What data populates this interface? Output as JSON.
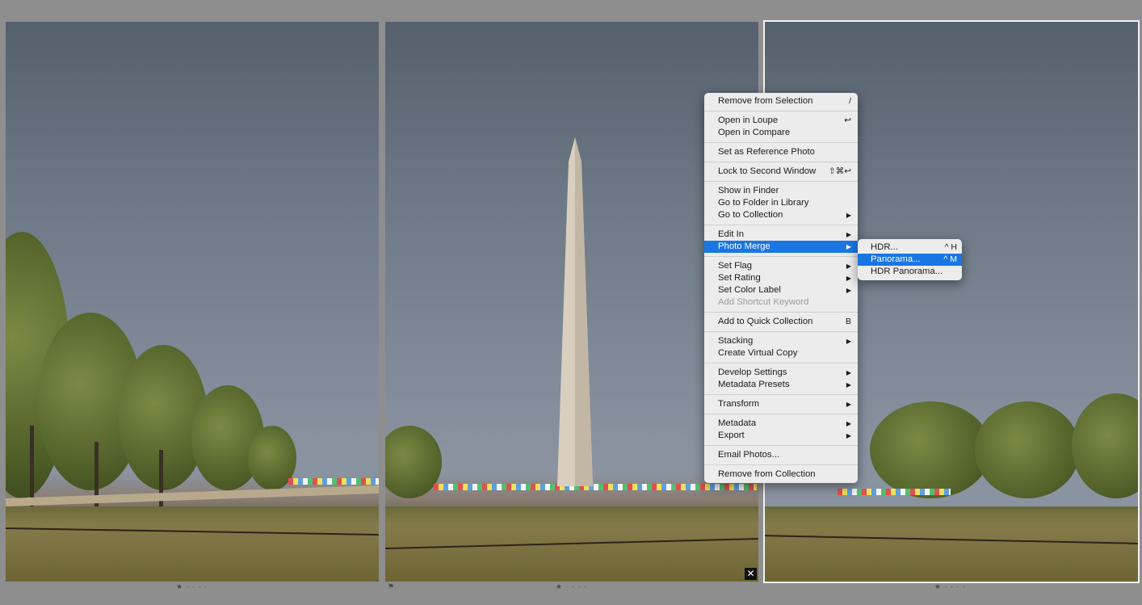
{
  "photos": [
    {
      "rating": "★ · · · ·"
    },
    {
      "rating": "★ · · · ·"
    },
    {
      "rating": "★ · · · ·"
    }
  ],
  "icons": {
    "flag": "⚑",
    "close": "✕"
  },
  "context_menu": {
    "groups": [
      [
        {
          "label": "Remove from Selection",
          "shortcut": "/"
        }
      ],
      [
        {
          "label": "Open in Loupe",
          "shortcut": "↩"
        },
        {
          "label": "Open in Compare"
        }
      ],
      [
        {
          "label": "Set as Reference Photo"
        }
      ],
      [
        {
          "label": "Lock to Second Window",
          "shortcut": "⇧⌘↩"
        }
      ],
      [
        {
          "label": "Show in Finder"
        },
        {
          "label": "Go to Folder in Library"
        },
        {
          "label": "Go to Collection",
          "submenu": true
        }
      ],
      [
        {
          "label": "Edit In",
          "submenu": true
        },
        {
          "label": "Photo Merge",
          "submenu": true,
          "highlighted": true
        }
      ],
      [
        {
          "label": "Set Flag",
          "submenu": true
        },
        {
          "label": "Set Rating",
          "submenu": true
        },
        {
          "label": "Set Color Label",
          "submenu": true
        },
        {
          "label": "Add Shortcut Keyword",
          "disabled": true
        }
      ],
      [
        {
          "label": "Add to Quick Collection",
          "shortcut": "B"
        }
      ],
      [
        {
          "label": "Stacking",
          "submenu": true
        },
        {
          "label": "Create Virtual Copy"
        }
      ],
      [
        {
          "label": "Develop Settings",
          "submenu": true
        },
        {
          "label": "Metadata Presets",
          "submenu": true
        }
      ],
      [
        {
          "label": "Transform",
          "submenu": true
        }
      ],
      [
        {
          "label": "Metadata",
          "submenu": true
        },
        {
          "label": "Export",
          "submenu": true
        }
      ],
      [
        {
          "label": "Email Photos..."
        }
      ],
      [
        {
          "label": "Remove from Collection"
        }
      ]
    ],
    "arrow_glyph": "▶"
  },
  "photo_merge_submenu": {
    "items": [
      {
        "label": "HDR...",
        "shortcut": "^ H"
      },
      {
        "label": "Panorama...",
        "shortcut": "^ M",
        "highlighted": true
      },
      {
        "label": "HDR Panorama..."
      }
    ]
  }
}
